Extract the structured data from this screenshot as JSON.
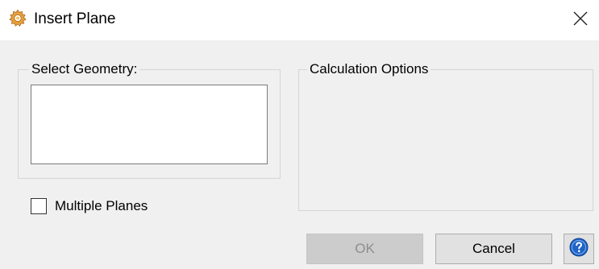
{
  "window": {
    "title": "Insert Plane",
    "app_icon": "gear-icon",
    "close_icon": "close-icon"
  },
  "select_geometry": {
    "label": "Select Geometry:"
  },
  "calculation_options": {
    "label": "Calculation Options"
  },
  "multiple_planes": {
    "label": "Multiple Planes",
    "checked": false
  },
  "buttons": {
    "ok_label": "OK",
    "ok_enabled": false,
    "cancel_label": "Cancel",
    "help_icon": "help-icon"
  },
  "colors": {
    "dialog_background": "#f0f0f0",
    "app_icon": "#e8a13a",
    "help_icon": "#1e63c6"
  }
}
